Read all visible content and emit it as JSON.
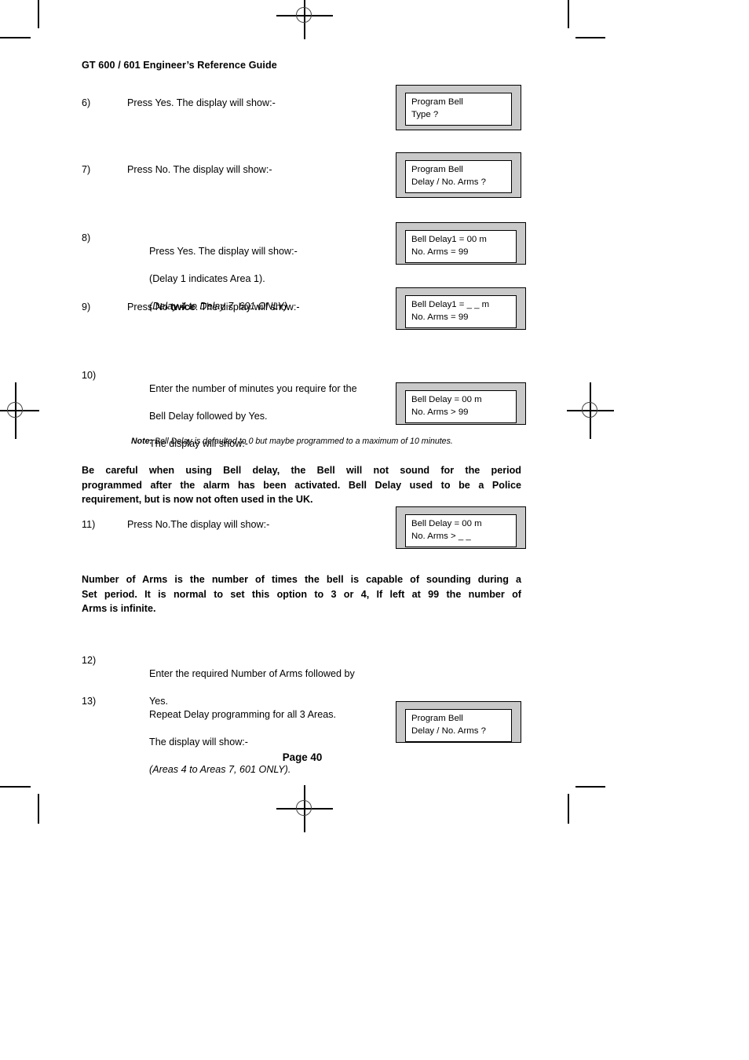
{
  "document": {
    "header": "GT 600 / 601 Engineer’s Reference Guide",
    "page_number": "Page  40"
  },
  "steps": [
    {
      "number": "6)",
      "lines": [
        "Press Yes. The display will show:-"
      ]
    },
    {
      "number": "7)",
      "lines": [
        "Press No. The display will show:-"
      ]
    },
    {
      "number": "8)",
      "line1": "Press Yes. The display will show:-",
      "line2": "(Delay 1 indicates Area 1).",
      "line3_italic": "(Delay 4 to Delay 7, 601 ONLY)."
    },
    {
      "number": "9)",
      "pre": "Press No ",
      "bold": "twice",
      "post": ". The display will show:-"
    },
    {
      "number": "10)",
      "line1": "Enter the number of minutes you require for the",
      "line2": "Bell Delay followed by Yes.",
      "line3": "The display will show:-"
    },
    {
      "number": "11)",
      "lines": [
        "Press No.The display will show:-"
      ]
    },
    {
      "number": "12)",
      "line1": "Enter the required Number of Arms followed by",
      "line2": "Yes."
    },
    {
      "number": "13)",
      "line1": "Repeat Delay programming for all 3 Areas.",
      "line2": "The display will show:-",
      "line3_italic": "(Areas 4 to Areas 7, 601 ONLY)."
    }
  ],
  "note": {
    "label": "Note:",
    "text": " Bell Delay is defaulted to 0 but maybe programmed to a maximum of 10 minutes."
  },
  "warnings": {
    "bell_delay": {
      "line1": "Be careful when using Bell delay, the Bell will not sound for the period",
      "line2": "programmed after the alarm has been activated. Bell Delay used to be a Police",
      "line3": "requirement, but is now not often used in the UK."
    },
    "number_of_arms": {
      "line1": "Number of Arms is the number of times the bell is capable of sounding during a",
      "line2": "Set period. It is normal to set this option to 3 or 4, If left at 99 the number of",
      "line3": "Arms is infinite."
    }
  },
  "displays": [
    {
      "id": "display-bell-type",
      "line1": "Program Bell",
      "line2": "Type ?"
    },
    {
      "id": "display-bell-delay-menu",
      "line1": "Program Bell",
      "line2": "Delay / No. Arms ?"
    },
    {
      "id": "display-delay1-00",
      "line1": "Bell Delay1 = 00 m",
      "line2": "No. Arms = 99"
    },
    {
      "id": "display-delay1-blank",
      "line1": "Bell Delay1 = _ _ m",
      "line2": "No. Arms = 99"
    },
    {
      "id": "display-delay-entry",
      "line1": "Bell Delay = 00 m",
      "line2": "No. Arms > 99"
    },
    {
      "id": "display-arms-entry",
      "line1": "Bell Delay = 00 m",
      "line2": "No. Arms > _ _"
    },
    {
      "id": "display-bell-delay-menu2",
      "line1": "Program Bell",
      "line2": "Delay / No. Arms ?"
    }
  ],
  "colors": {
    "lcd_frame": "#c9c9c9",
    "lcd_screen": "#ffffff",
    "ink": "#000000"
  }
}
